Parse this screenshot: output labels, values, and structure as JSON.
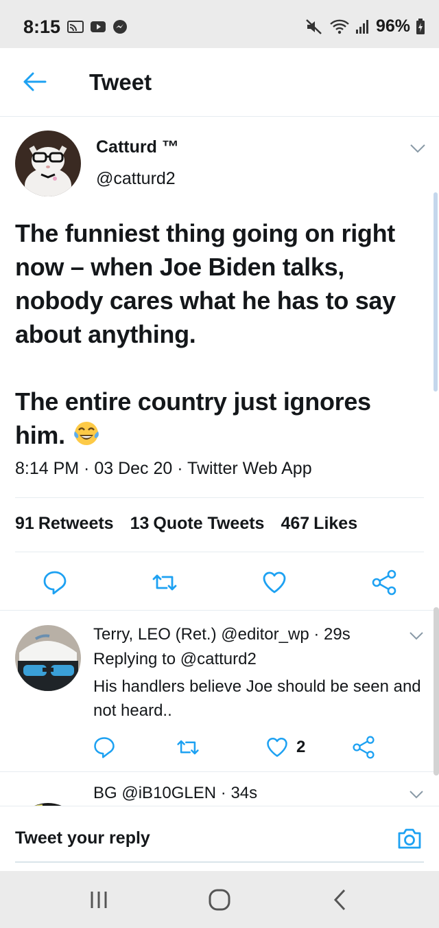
{
  "status_bar": {
    "time": "8:15",
    "battery": "96%"
  },
  "header": {
    "title": "Tweet"
  },
  "tweet": {
    "author_name": "Catturd ™",
    "author_handle": "@catturd2",
    "text": "The funniest thing going on right now – when Joe Biden talks, nobody cares what he has to say about anything.\n\nThe entire country just ignores him.",
    "emoji": "face-with-tears-of-joy-icon",
    "meta": "8:14 PM · 03 Dec 20 · Twitter Web App",
    "stats": {
      "retweets_count": "91",
      "retweets_label": "Retweets",
      "quote_count": "13",
      "quote_label": "Quote Tweets",
      "likes_count": "467",
      "likes_label": "Likes"
    }
  },
  "replies": [
    {
      "name": "Terry, LEO (Ret.)",
      "handle": "@editor_wp",
      "time": "· 29s",
      "replying_to": "Replying to @catturd2",
      "text": "His handlers believe Joe should be seen and not heard..",
      "likes": "2"
    },
    {
      "name": "BG",
      "handle": "@iB10GLEN",
      "time": "· 34s"
    }
  ],
  "composer": {
    "placeholder": "Tweet your reply"
  },
  "colors": {
    "accent": "#1da1f2",
    "text": "#14171a",
    "divider": "#e6ecf0",
    "system_bar": "#ebebeb"
  }
}
